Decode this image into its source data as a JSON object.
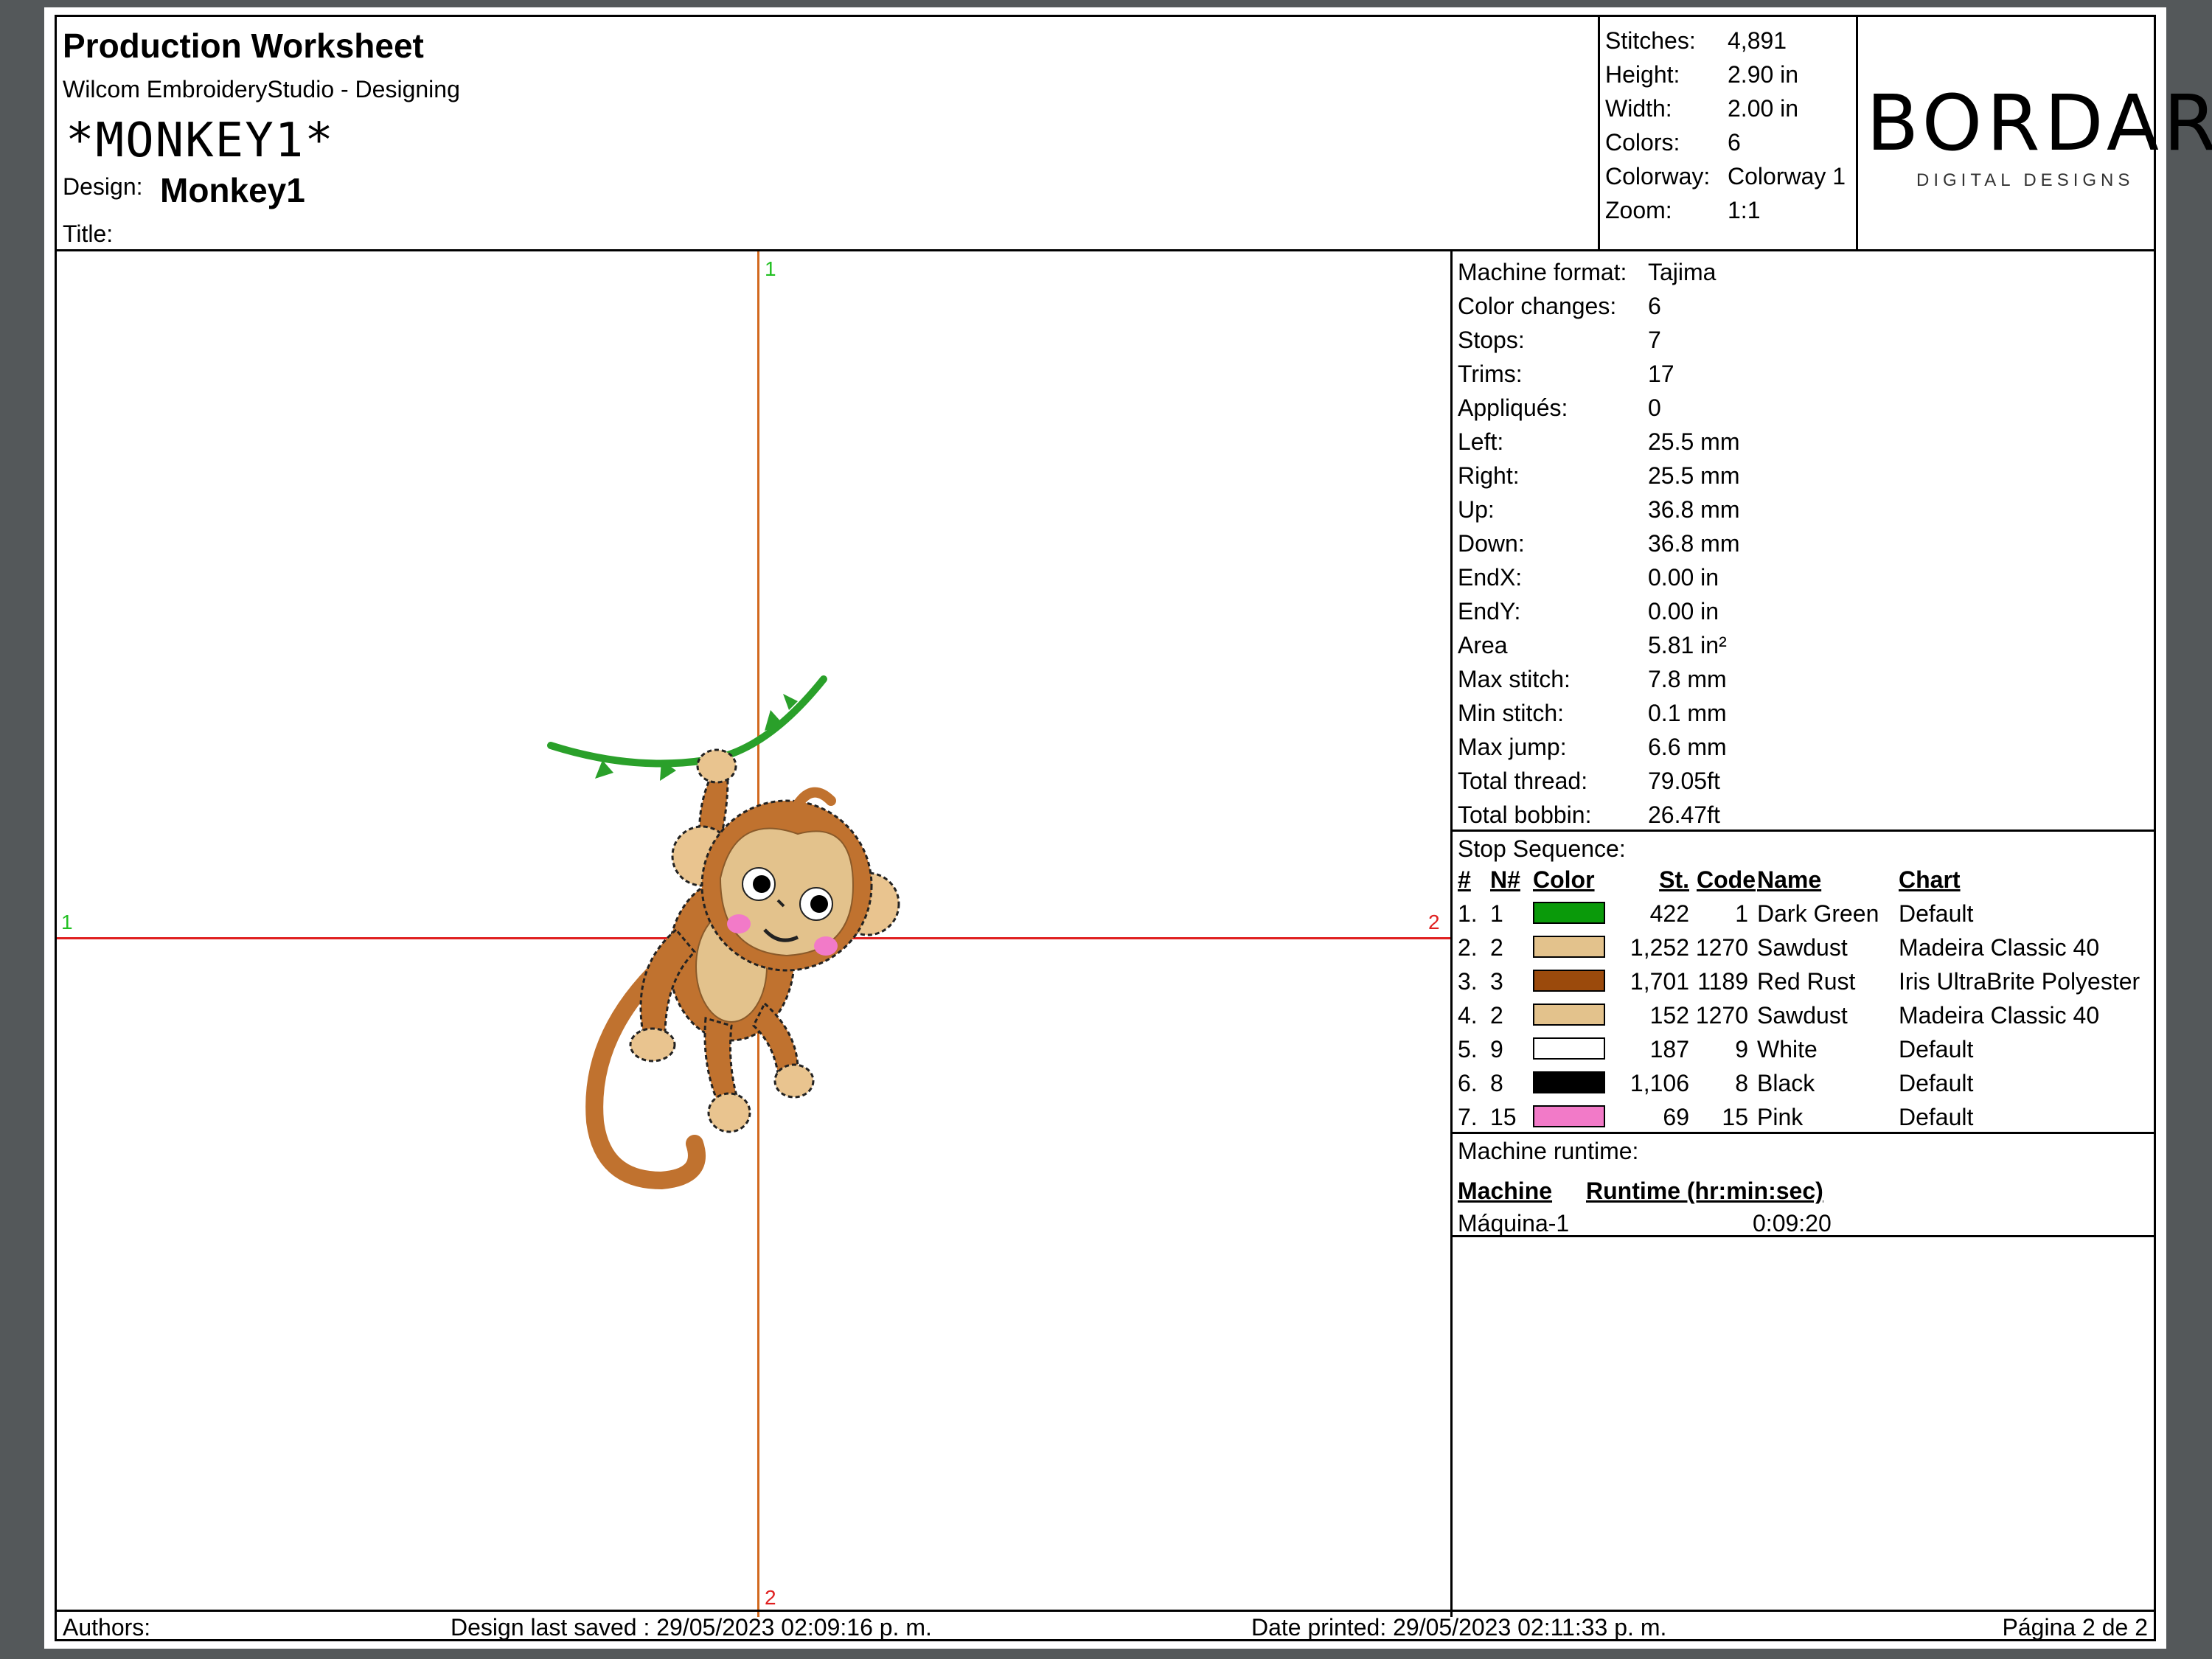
{
  "header": {
    "title": "Production Worksheet",
    "software": "Wilcom EmbroideryStudio - Designing",
    "barcode_text": "*MONKEY1*",
    "design_label": "Design:",
    "design_value": "Monkey1",
    "title_label": "Title:"
  },
  "summary": {
    "rows": [
      {
        "label": "Stitches:",
        "value": "4,891"
      },
      {
        "label": "Height:",
        "value": "2.90 in"
      },
      {
        "label": "Width:",
        "value": "2.00 in"
      },
      {
        "label": "Colors:",
        "value": "6"
      },
      {
        "label": "Colorway:",
        "value": "Colorway 1"
      },
      {
        "label": "Zoom:",
        "value": "1:1"
      }
    ]
  },
  "logo": {
    "brand": "BORDART",
    "tagline": "DIGITAL DESIGNS"
  },
  "details": {
    "rows": [
      {
        "label": "Machine format:",
        "value": "Tajima"
      },
      {
        "label": "Color changes:",
        "value": "6"
      },
      {
        "label": "Stops:",
        "value": "7"
      },
      {
        "label": "Trims:",
        "value": "17"
      },
      {
        "label": "Appliqués:",
        "value": "0"
      },
      {
        "label": "Left:",
        "value": "25.5 mm"
      },
      {
        "label": "Right:",
        "value": "25.5 mm"
      },
      {
        "label": "Up:",
        "value": "36.8 mm"
      },
      {
        "label": "Down:",
        "value": "36.8 mm"
      },
      {
        "label": "EndX:",
        "value": "0.00 in"
      },
      {
        "label": "EndY:",
        "value": "0.00 in"
      },
      {
        "label": "Area",
        "value": "5.81 in²"
      },
      {
        "label": "Max stitch:",
        "value": "7.8 mm"
      },
      {
        "label": "Min stitch:",
        "value": "0.1 mm"
      },
      {
        "label": "Max jump:",
        "value": "6.6 mm"
      },
      {
        "label": "Total thread:",
        "value": "79.05ft"
      },
      {
        "label": "Total bobbin:",
        "value": "26.47ft"
      }
    ]
  },
  "stop_sequence": {
    "label": "Stop Sequence:",
    "headers": {
      "num": "#",
      "n": "N#",
      "color": "Color",
      "st": "St.",
      "code": "Code",
      "name": "Name",
      "chart": "Chart"
    },
    "rows": [
      {
        "num": "1.",
        "n": "1",
        "color": "#0a9a0a",
        "st": "422",
        "code": "1",
        "name": "Dark Green",
        "chart": "Default"
      },
      {
        "num": "2.",
        "n": "2",
        "color": "#e3c28c",
        "st": "1,252",
        "code": "1270",
        "name": "Sawdust",
        "chart": "Madeira Classic 40"
      },
      {
        "num": "3.",
        "n": "3",
        "color": "#9b4a0c",
        "st": "1,701",
        "code": "1189",
        "name": "Red Rust",
        "chart": "Iris UltraBrite Polyester"
      },
      {
        "num": "4.",
        "n": "2",
        "color": "#e3c28c",
        "st": "152",
        "code": "1270",
        "name": "Sawdust",
        "chart": "Madeira Classic 40"
      },
      {
        "num": "5.",
        "n": "9",
        "color": "#ffffff",
        "st": "187",
        "code": "9",
        "name": "White",
        "chart": "Default"
      },
      {
        "num": "6.",
        "n": "8",
        "color": "#000000",
        "st": "1,106",
        "code": "8",
        "name": "Black",
        "chart": "Default"
      },
      {
        "num": "7.",
        "n": "15",
        "color": "#f27ac8",
        "st": "69",
        "code": "15",
        "name": "Pink",
        "chart": "Default"
      }
    ]
  },
  "runtime": {
    "label": "Machine runtime:",
    "col_machine": "Machine",
    "col_runtime": "Runtime (hr:min:sec)",
    "rows": [
      {
        "machine": "Máquina-1",
        "runtime": "0:09:20"
      }
    ]
  },
  "canvas": {
    "axis_top": "1",
    "axis_bottom": "2",
    "axis_left": "1",
    "axis_right": "2"
  },
  "footer": {
    "authors": "Authors:",
    "saved": "Design last saved : 29/05/2023 02:09:16 p. m.",
    "printed": "Date printed: 29/05/2023 02:11:33 p. m.",
    "page": "Página 2 de 2"
  },
  "colors": {
    "axis_vertical": "#d2691e",
    "axis_horizontal": "#e02020",
    "axis_label_green": "#22c022",
    "axis_label_red": "#e02020"
  }
}
